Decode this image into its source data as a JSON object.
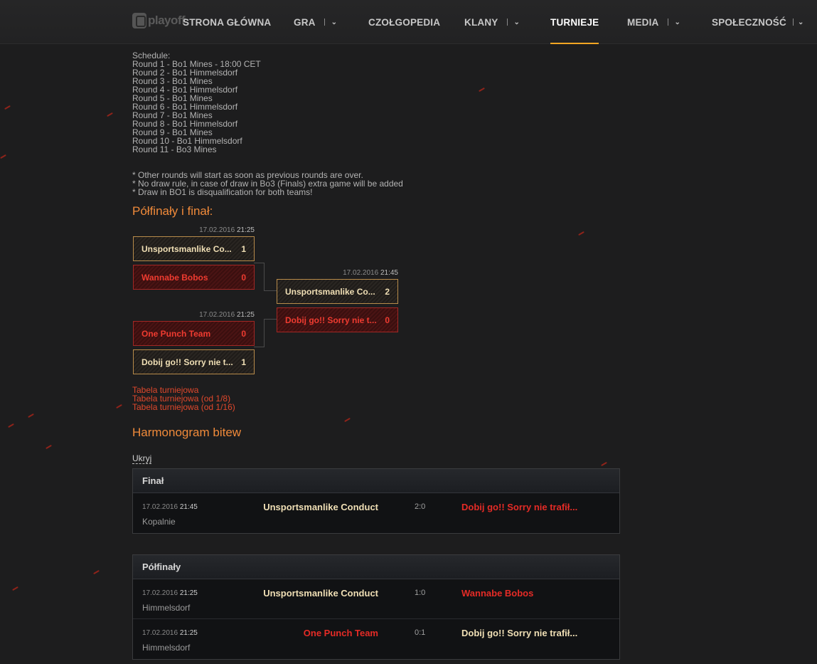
{
  "nav": {
    "logo_text": "playoff",
    "items": [
      {
        "label": "STRONA GŁÓWNA",
        "dropdown": false,
        "active": false
      },
      {
        "label": "GRA",
        "dropdown": true,
        "active": false
      },
      {
        "label": "CZOŁGOPEDIA",
        "dropdown": false,
        "active": false
      },
      {
        "label": "KLANY",
        "dropdown": true,
        "active": false
      },
      {
        "label": "TURNIEJE",
        "dropdown": false,
        "active": true
      },
      {
        "label": "MEDIA",
        "dropdown": true,
        "active": false
      },
      {
        "label": "SPOŁECZNOŚĆ",
        "dropdown": true,
        "active": false
      }
    ],
    "chevron_icon": "chevron-down-icon"
  },
  "schedule": {
    "lines": [
      "Schedule:",
      "Round 1 - Bo1 Mines - 18:00 CET",
      "Round 2 - Bo1 Himmelsdorf",
      "Round 3 - Bo1 Mines",
      "Round 4 - Bo1 Himmelsdorf",
      "Round 5 - Bo1 Mines",
      "Round 6 - Bo1 Himmelsdorf",
      "Round 7 - Bo1 Mines",
      "Round 8 - Bo1 Himmelsdorf",
      "Round 9 - Bo1 Mines",
      "Round 10 - Bo1 Himmelsdorf",
      "Round 11 - Bo3 Mines"
    ],
    "notes": [
      "* Other rounds will start as soon as previous rounds are over.",
      "* No draw rule, in case of draw in Bo3 (Finals) extra game will be added",
      "* Draw in BO1 is disqualification for both teams!"
    ]
  },
  "bracket": {
    "title": "Półfinały i finał:",
    "semi1": {
      "date": "17.02.2016",
      "time": "21:25",
      "team1": {
        "name": "Unsportsmanlike Co...",
        "score": "1"
      },
      "team2": {
        "name": "Wannabe Bobos",
        "score": "0"
      }
    },
    "semi2": {
      "date": "17.02.2016",
      "time": "21:25",
      "team1": {
        "name": "One Punch Team",
        "score": "0"
      },
      "team2": {
        "name": "Dobij go!! Sorry nie t...",
        "score": "1"
      }
    },
    "final": {
      "date": "17.02.2016",
      "time": "21:45",
      "team1": {
        "name": "Unsportsmanlike Co...",
        "score": "2"
      },
      "team2": {
        "name": "Dobij go!! Sorry nie t...",
        "score": "0"
      }
    }
  },
  "links": [
    "Tabela turniejowa",
    "Tabela turniejowa (od 1/8)",
    "Tabela turniejowa (od 1/16)"
  ],
  "harmonogram": {
    "title": "Harmonogram bitew",
    "toggle": "Ukryj",
    "final": {
      "title": "Finał",
      "matches": [
        {
          "date": "17.02.2016",
          "time": "21:45",
          "map": "Kopalnie",
          "left": "Unsportsmanlike Conduct",
          "score": "2:0",
          "right": "Dobij go!! Sorry nie trafił..."
        }
      ]
    },
    "semis": {
      "title": "Półfinały",
      "matches": [
        {
          "date": "17.02.2016",
          "time": "21:25",
          "map": "Himmelsdorf",
          "left": "Unsportsmanlike Conduct",
          "score": "1:0",
          "right": "Wannabe Bobos"
        },
        {
          "date": "17.02.2016",
          "time": "21:25",
          "map": "Himmelsdorf",
          "left": "One Punch Team",
          "score": "0:1",
          "right": "Dobij go!! Sorry nie trafił..."
        }
      ]
    }
  },
  "colors": {
    "accent": "#f5a623",
    "winner": "#f0dfb5",
    "loser": "#e52b26",
    "heading": "#f08a3a",
    "link": "#e0482c"
  }
}
